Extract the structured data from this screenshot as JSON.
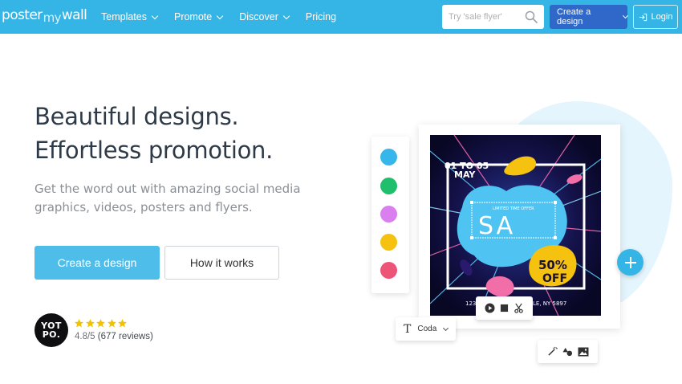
{
  "brand": {
    "logo_left": "poster",
    "logo_mid": "my",
    "logo_right": "wall"
  },
  "nav": {
    "items": [
      {
        "label": "Templates",
        "dropdown": true
      },
      {
        "label": "Promote",
        "dropdown": true
      },
      {
        "label": "Discover",
        "dropdown": true
      },
      {
        "label": "Pricing",
        "dropdown": false
      }
    ],
    "search_placeholder": "Try 'sale flyer'",
    "create_label": "Create a design",
    "login_label": "Login"
  },
  "hero": {
    "title_line1": "Beautiful designs.",
    "title_line2": "Effortless promotion.",
    "subtitle_line1": "Get the word out with amazing social media",
    "subtitle_line2": "graphics, videos, posters and flyers.",
    "cta_primary": "Create a design",
    "cta_secondary": "How it works"
  },
  "reviews": {
    "badge_line1": "YOT",
    "badge_line2": "PO.",
    "stars": 5,
    "score": "4.8/5",
    "count": "(677 reviews)"
  },
  "illustration": {
    "swatch_colors": [
      "#36b6ea",
      "#1fbf6b",
      "#d980ee",
      "#f5c20f",
      "#ec5578"
    ],
    "poster": {
      "date_line1": "01 TO 05",
      "date_line2": "MAY",
      "tagline": "LIMITED TIME OFFER",
      "headline": "SA",
      "discount_line1": "50%",
      "discount_line2": "OFF",
      "address_left": "123",
      "address_right": "LE, NY 5897"
    },
    "font_picker_label": "Coda",
    "colors": {
      "accent": "#34b5e5",
      "dark_blue": "#3068c9",
      "poster_bg": "#0c0b2e",
      "blob": "#4fc3f2",
      "yellow": "#f5c20f",
      "pink": "#f16ea9"
    }
  }
}
